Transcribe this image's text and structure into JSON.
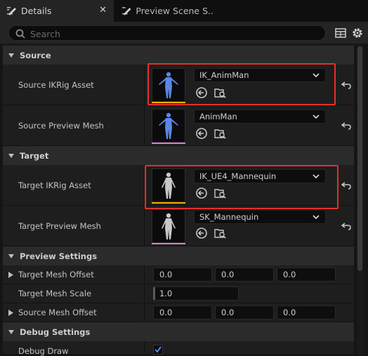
{
  "tabs": [
    {
      "label": "Details",
      "close": "✕"
    },
    {
      "label": "Preview Scene S..."
    }
  ],
  "search": {
    "placeholder": "Search"
  },
  "sections": {
    "source": {
      "title": "Source",
      "ikrig_label": "Source IKRig Asset",
      "ikrig_value": "IK_AnimMan",
      "mesh_label": "Source Preview Mesh",
      "mesh_value": "AnimMan"
    },
    "target": {
      "title": "Target",
      "ikrig_label": "Target IKRig Asset",
      "ikrig_value": "IK_UE4_Mannequin",
      "mesh_label": "Target Preview Mesh",
      "mesh_value": "SK_Mannequin"
    },
    "preview": {
      "title": "Preview Settings",
      "target_offset_label": "Target Mesh Offset",
      "target_offset": [
        "0.0",
        "0.0",
        "0.0"
      ],
      "target_scale_label": "Target Mesh Scale",
      "target_scale": "1.0",
      "source_offset_label": "Source Mesh Offset",
      "source_offset": [
        "0.0",
        "0.0",
        "0.0"
      ]
    },
    "debug": {
      "title": "Debug Settings",
      "draw_label": "Debug Draw"
    }
  },
  "icons": {
    "details": "pencil-icon",
    "preview": "pencil-icon",
    "search": "search-icon",
    "table": "table-view-icon",
    "settings": "gear-icon",
    "browse": "use-selected-asset-icon",
    "find": "browse-to-asset-icon",
    "reset": "reset-to-default-icon"
  },
  "colors": {
    "ikrig_bar": "#f0b000",
    "mesh_bar": "#d67cd6",
    "highlight": "#e5302a",
    "source_mesh": "#5b86e8",
    "target_mesh": "#c8c8c8"
  }
}
